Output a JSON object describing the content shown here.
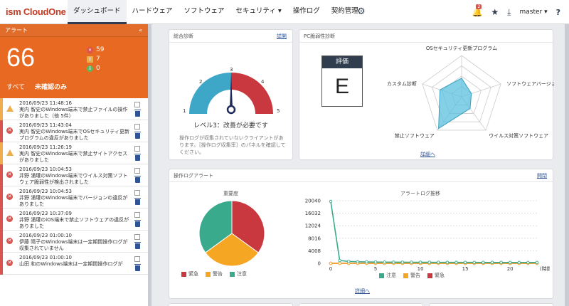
{
  "app": {
    "logo_prefix": "ism",
    "logo_name": "CloudOne"
  },
  "nav": {
    "items": [
      {
        "label": "ダッシュボード"
      },
      {
        "label": "ハードウェア"
      },
      {
        "label": "ソフトウェア"
      },
      {
        "label": "セキュリティ ▾"
      },
      {
        "label": "操作ログ"
      },
      {
        "label": "契約管理"
      }
    ],
    "notification_count": "2",
    "user": "master ▾",
    "help": "?"
  },
  "alerts": {
    "header": "アラート",
    "collapse": "«",
    "total": "66",
    "counts": {
      "error": "59",
      "warning": "7",
      "info": "0"
    },
    "filter_all": "すべて",
    "filter_unconfirmed": "未確認のみ",
    "items": [
      {
        "level": "warn",
        "datetime": "2016/09/23 11:48:16",
        "message": "実内 智史のWindows端末で禁止ファイルの操作がありました（他 5件）"
      },
      {
        "level": "err",
        "datetime": "2016/09/23 11:43:04",
        "message": "実内 智史のWindows端末でOSセキュリティ更新プログラムの違反がありました"
      },
      {
        "level": "warn",
        "datetime": "2016/09/23 11:26:19",
        "message": "実内 智史のWindows端末で禁止サイトアクセスがありました"
      },
      {
        "level": "err",
        "datetime": "2016/09/23 10:04:53",
        "message": "井野 涌瓘のWindows端末でウイルス対策ソフトウェア脆弱性が検出されました"
      },
      {
        "level": "err",
        "datetime": "2016/09/23 10:04:53",
        "message": "井野 涌瓘のWindows端末でバージョンの違反がありました"
      },
      {
        "level": "err",
        "datetime": "2016/09/23 10:37:09",
        "message": "井野 涌瓘のiOS端末で禁止ソフトウェアの違反がありました"
      },
      {
        "level": "err",
        "datetime": "2016/09/23 01:00:10",
        "message": "伊藤 晴子のWindows端末は一定期間操作ログが収集されていません"
      },
      {
        "level": "err",
        "datetime": "2016/09/23 01:00:10",
        "message": "山田 和のWindows端末は一定期間操作ログが"
      }
    ]
  },
  "overall": {
    "title": "総合診断",
    "link": "詳開",
    "gauge_ticks": [
      "1",
      "2",
      "3",
      "4",
      "5"
    ],
    "level_text": "レベル3：改善が必要です",
    "gauge_value": 3,
    "note": "操作ログが収集されていないクライアントがあります。［操作ログ収集率］のパネルを確認してください。"
  },
  "pc": {
    "title": "PC脆弱性診断",
    "eval_label": "評価",
    "eval_value": "E",
    "axes": [
      "OSセキュリティ更新プログラム",
      "ソフトウェアバージョン",
      "ウイルス対策ソフトウェア",
      "禁止ソフトウェア",
      "カスタム診断"
    ],
    "scores": [
      0.45,
      0.25,
      0.35,
      0.95,
      0.55
    ],
    "link": "詳細へ"
  },
  "oplog": {
    "title": "操作ログアラート",
    "link": "開閉",
    "pie_title": "重要度",
    "pie": [
      {
        "name": "緊急",
        "value": 0.35,
        "color": "#c9373f"
      },
      {
        "name": "警告",
        "value": 0.3,
        "color": "#f5a623"
      },
      {
        "name": "注意",
        "value": 0.35,
        "color": "#3aaa8c"
      }
    ],
    "trend_title": "アラートログ推移",
    "link_detail": "詳細へ",
    "colors": {
      "kinkyu": "#c9373f",
      "keikoku": "#f5a623",
      "chui": "#3aaa8c"
    }
  },
  "chart_data": {
    "type": "line",
    "title": "アラートログ推移",
    "xlabel": "(時間)",
    "ylabel": "",
    "x": [
      0,
      1,
      2,
      3,
      4,
      5,
      6,
      7,
      8,
      9,
      10,
      11,
      12,
      13,
      14,
      15,
      16,
      17,
      18,
      19,
      20,
      21,
      22,
      23
    ],
    "xticks": [
      "0",
      "5",
      "10",
      "15",
      "20"
    ],
    "yticks": [
      "0",
      "4008",
      "8016",
      "12024",
      "16032",
      "20040"
    ],
    "ylim": [
      0,
      20040
    ],
    "xlim": [
      0,
      23
    ],
    "series": [
      {
        "name": "注意",
        "color": "#3aaa8c",
        "values": [
          19800,
          900,
          600,
          500,
          450,
          400,
          380,
          360,
          350,
          340,
          330,
          320,
          310,
          300,
          300,
          290,
          290,
          280,
          280,
          280,
          270,
          270,
          270,
          270
        ]
      },
      {
        "name": "警告",
        "color": "#f5a623",
        "values": [
          0,
          0,
          0,
          0,
          0,
          0,
          0,
          0,
          0,
          0,
          0,
          0,
          0,
          0,
          0,
          0,
          0,
          0,
          0,
          0,
          0,
          0,
          0,
          0
        ]
      },
      {
        "name": "緊急",
        "color": "#c9373f",
        "values": [
          0,
          0,
          0,
          0,
          0,
          0,
          0,
          0,
          0,
          0,
          0,
          0,
          0,
          0,
          0,
          0,
          0,
          0,
          0,
          0,
          0,
          0,
          0,
          0
        ]
      }
    ]
  }
}
